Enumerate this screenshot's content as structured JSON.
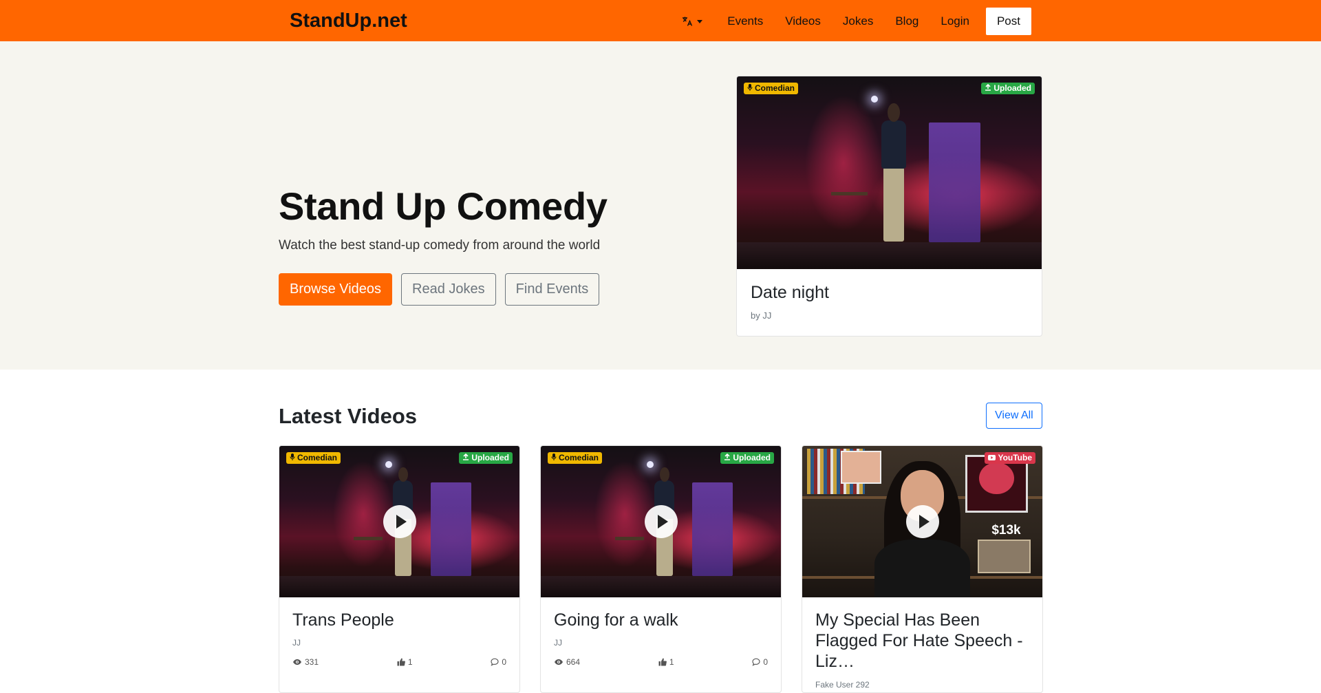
{
  "navbar": {
    "brand": "StandUp.net",
    "language_icon": "translate-icon",
    "links": [
      "Events",
      "Videos",
      "Jokes",
      "Blog",
      "Login"
    ],
    "post_label": "Post",
    "colors": {
      "accent": "#ff6600"
    }
  },
  "hero": {
    "title": "Stand Up Comedy",
    "subtitle": "Watch the best stand-up comedy from around the world",
    "buttons": {
      "browse": "Browse Videos",
      "jokes": "Read Jokes",
      "events": "Find Events"
    },
    "featured": {
      "badge_left": "Comedian",
      "badge_left_icon": "microphone-icon",
      "badge_right": "Uploaded",
      "badge_right_icon": "upload-icon",
      "title": "Date night",
      "by": "by JJ"
    }
  },
  "latest": {
    "title": "Latest Videos",
    "view_all": "View All",
    "videos": [
      {
        "title": "Trans People",
        "author": "JJ",
        "views": "331",
        "likes": "1",
        "comments": "0",
        "badge_left": "Comedian",
        "badge_right": "Uploaded"
      },
      {
        "title": "Going for a walk",
        "author": "JJ",
        "views": "664",
        "likes": "1",
        "comments": "0",
        "badge_left": "Comedian",
        "badge_right": "Uploaded"
      },
      {
        "title": "My Special Has Been Flagged For Hate Speech - Liz…",
        "author": "Fake User 292",
        "badge_right": "YouTube",
        "thumbnail_text": "$13k"
      }
    ]
  }
}
